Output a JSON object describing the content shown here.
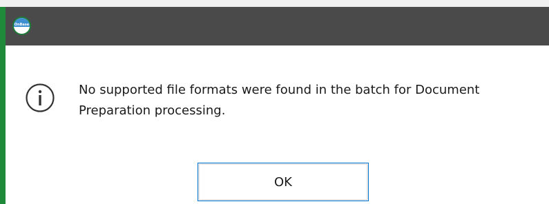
{
  "window": {
    "title": "",
    "app_icon": "onbase-logo-icon"
  },
  "dialog": {
    "icon": "info-icon",
    "message": "No supported file formats were found in the batch for Document\nPreparation processing.",
    "ok_label": "OK"
  },
  "colors": {
    "titlebar": "#4a4a4a",
    "border_accent": "#1f8a3a",
    "button_focus": "#0078d7"
  }
}
